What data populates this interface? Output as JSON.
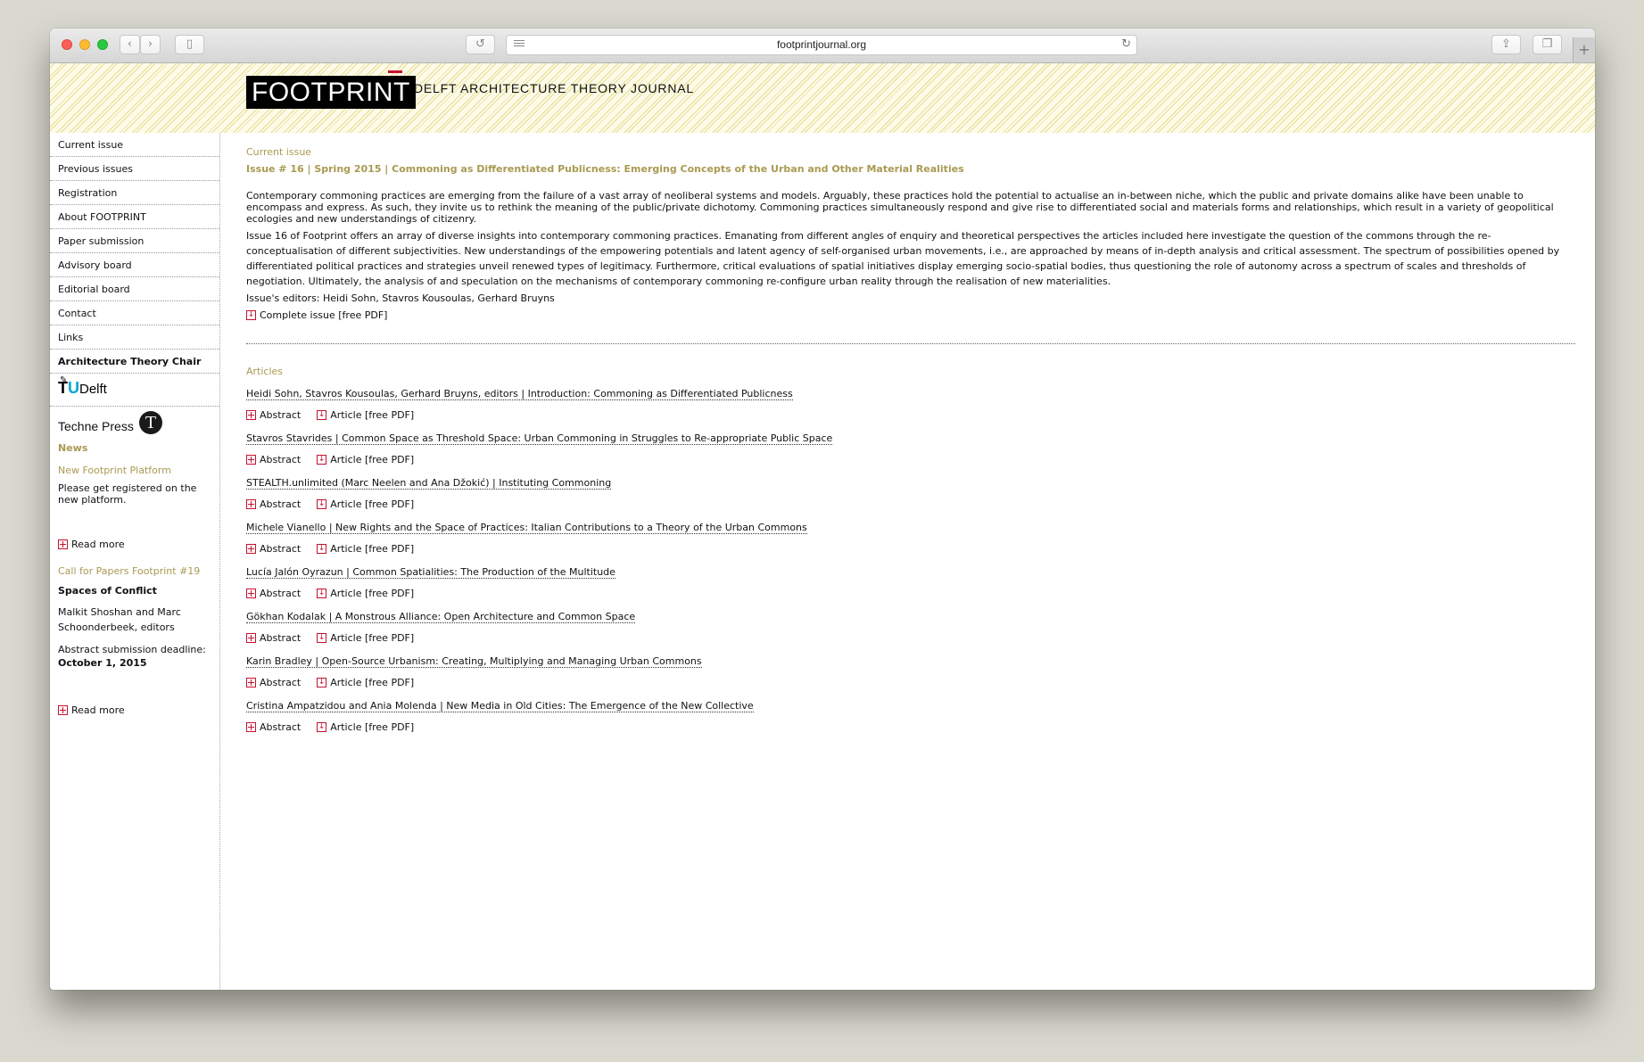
{
  "browser": {
    "url": "footprintjournal.org",
    "new_tab_label": "+"
  },
  "banner": {
    "logo": "FOOTPRINT",
    "tagline": "DELFT ARCHITECTURE THEORY JOURNAL"
  },
  "sidebar": {
    "nav": [
      {
        "label": "Current issue"
      },
      {
        "label": "Previous issues"
      },
      {
        "label": "Registration"
      },
      {
        "label": "About FOOTPRINT"
      },
      {
        "label": "Paper submission"
      },
      {
        "label": "Advisory board"
      },
      {
        "label": "Editorial board"
      },
      {
        "label": "Contact"
      },
      {
        "label": "Links"
      },
      {
        "label": "Architecture Theory Chair"
      }
    ],
    "tudelft": {
      "t": "T",
      "u": "U",
      "rest": "Delft"
    },
    "techne": {
      "label": "Techne Press",
      "logo_letter": "T"
    },
    "news": {
      "heading": "News",
      "items": [
        {
          "title": "New Footprint Platform",
          "body": "Please get registered on the new platform.",
          "read_more": "Read more"
        },
        {
          "title": "Call for Papers Footprint #19",
          "subtitle": "Spaces of Conflict",
          "editors": "Malkit Shoshan and Marc Schoonderbeek, editors",
          "deadline_label": "Abstract submission deadline:",
          "deadline": "October 1, 2015",
          "read_more": "Read more"
        }
      ]
    }
  },
  "main": {
    "section_label": "Current issue",
    "issue_title": "Issue # 16 | Spring 2015 | Commoning as Differentiated Publicness: Emerging Concepts of the Urban and Other Material Realities",
    "intro_1": "Contemporary commoning practices are emerging from the failure of a vast array of neoliberal systems and models. Arguably, these practices hold the potential to actualise an in-between niche, which the public and private domains alike have been unable to encompass and express. As such, they invite us to rethink the meaning of the public/private dichotomy. Commoning practices simultaneously respond and give rise to differentiated social and materials forms and relationships, which result in a variety of geopolitical ecologies and new understandings of citizenry.",
    "intro_2": "Issue 16 of Footprint offers an array of diverse insights into contemporary commoning practices. Emanating from different angles of enquiry and theoretical perspectives the articles included here investigate the question of the commons through the re-conceptualisation of different subjectivities. New understandings of the empowering potentials and latent agency of self-organised urban movements, i.e., are approached by means of in-depth analysis and critical assessment. The spectrum of possibilities opened by differentiated political practices and strategies unveil renewed types of legitimacy. Furthermore, critical evaluations of spatial initiatives display emerging socio-spatial bodies, thus questioning the role of autonomy across a spectrum of scales and thresholds of negotiation. Ultimately, the analysis of and speculation on the mechanisms of contemporary commoning re-configure urban reality through the realisation of new materialities.",
    "editors": "Issue's editors: Heidi Sohn, Stavros Kousoulas, Gerhard Bruyns",
    "complete_issue": "Complete issue [free PDF]",
    "articles_label": "Articles",
    "abstract_label": "Abstract",
    "article_label": "Article [free PDF]",
    "articles": [
      {
        "title": "Heidi Sohn, Stavros Kousoulas, Gerhard Bruyns, editors | Introduction: Commoning as Differentiated Publicness"
      },
      {
        "title": "Stavros Stavrides | Common Space as Threshold Space: Urban Commoning in Struggles to Re-appropriate Public Space"
      },
      {
        "title": "STEALTH.unlimited (Marc Neelen and Ana Džokić) | Instituting Commoning"
      },
      {
        "title": "Michele Vianello | New Rights and the Space of Practices: Italian Contributions to a Theory of the Urban Commons"
      },
      {
        "title": "Lucía Jalón Oyrazun | Common Spatialities: The Production of the Multitude"
      },
      {
        "title": "Gökhan Kodalak | A Monstrous Alliance: Open Architecture and Common Space"
      },
      {
        "title": "Karin Bradley | Open-Source Urbanism: Creating, Multiplying and Managing Urban Commons"
      },
      {
        "title": "Cristina Ampatzidou and Ania Molenda | New Media in Old Cities: The Emergence of the New Collective"
      }
    ]
  },
  "colors": {
    "accent_gold": "#a99a52",
    "icon_red": "#c4122f",
    "tudelft_blue": "#00a6d6"
  }
}
